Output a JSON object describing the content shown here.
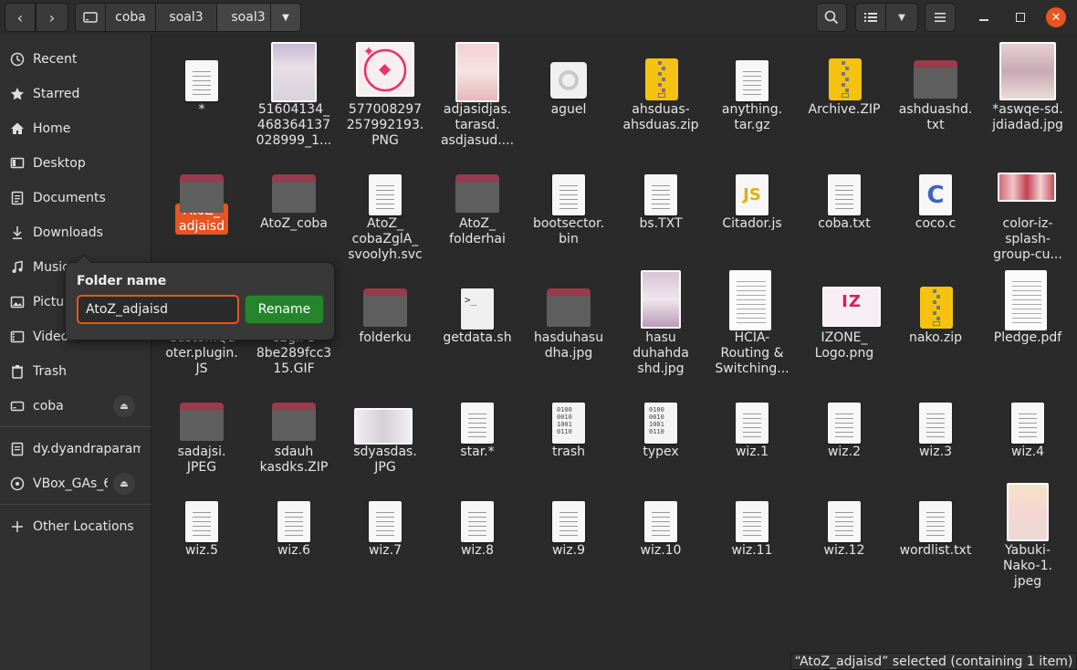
{
  "path": [
    "coba",
    "soal3",
    "soal3"
  ],
  "sidebar": {
    "items": [
      {
        "label": "Recent",
        "icon": "clock-icon"
      },
      {
        "label": "Starred",
        "icon": "star-icon"
      },
      {
        "label": "Home",
        "icon": "home-icon"
      },
      {
        "label": "Desktop",
        "icon": "desktop-icon"
      },
      {
        "label": "Documents",
        "icon": "documents-icon"
      },
      {
        "label": "Downloads",
        "icon": "download-icon"
      },
      {
        "label": "Music",
        "icon": "music-icon"
      },
      {
        "label": "Pictures",
        "icon": "pictures-icon"
      },
      {
        "label": "Videos",
        "icon": "videos-icon"
      },
      {
        "label": "Trash",
        "icon": "trash-icon"
      },
      {
        "label": "coba",
        "icon": "drive-icon"
      },
      {
        "label": "dy.dyandraparamitha...",
        "icon": "network-icon"
      },
      {
        "label": "VBox_GAs_6...",
        "icon": "disc-icon"
      },
      {
        "label": "Other Locations",
        "icon": "plus-icon"
      }
    ]
  },
  "files": [
    {
      "name": "*",
      "icon": "text"
    },
    {
      "name": "51604134_468364137028999_1...",
      "icon": "photo"
    },
    {
      "name": "577008297257992193.PNG",
      "icon": "png-logo"
    },
    {
      "name": "adjasidjas.tarasd.asdjasud....",
      "icon": "photo"
    },
    {
      "name": "aguel",
      "icon": "exec"
    },
    {
      "name": "ahsduas-ahsduas.zip",
      "icon": "zip"
    },
    {
      "name": "anything.tar.gz",
      "icon": "text"
    },
    {
      "name": "Archive.ZIP",
      "icon": "zip"
    },
    {
      "name": "ashduashd.txt",
      "icon": "folder"
    },
    {
      "name": "*aswqe-sd.jdiadad.jpg",
      "icon": "photo"
    },
    {
      "name": "AtoZ_adjaisd",
      "icon": "folder",
      "selected": true
    },
    {
      "name": "AtoZ_coba",
      "icon": "folder"
    },
    {
      "name": "AtoZ_cobaZglA_svoolyh.svc",
      "icon": "text"
    },
    {
      "name": "AtoZ_folderhai",
      "icon": "folder"
    },
    {
      "name": "bootsector.bin",
      "icon": "text"
    },
    {
      "name": "bs.TXT",
      "icon": "text"
    },
    {
      "name": "Citador.js",
      "icon": "js"
    },
    {
      "name": "coba.txt",
      "icon": "text"
    },
    {
      "name": "coco.c",
      "icon": "c"
    },
    {
      "name": "color-iz-splash-group-cu...",
      "icon": "group-photo"
    },
    {
      "name": "CustomQuoter.plugin.JS",
      "icon": "hidden"
    },
    {
      "name": "e2gif-58be289fcc315.GIF",
      "icon": "hidden"
    },
    {
      "name": "folderku",
      "icon": "folder"
    },
    {
      "name": "getdata.sh",
      "icon": "script"
    },
    {
      "name": "hasduhasudha.jpg",
      "icon": "folder"
    },
    {
      "name": "hasuduhahdashd.jpg",
      "icon": "photo"
    },
    {
      "name": "HCIA-Routing & Switching...",
      "icon": "pdf"
    },
    {
      "name": "IZONE_Logo.png",
      "icon": "izone"
    },
    {
      "name": "nako.zip",
      "icon": "zip"
    },
    {
      "name": "Pledge.pdf",
      "icon": "pdf"
    },
    {
      "name": "sadajsi.JPEG",
      "icon": "folder"
    },
    {
      "name": "sdauhkasdks.ZIP",
      "icon": "folder"
    },
    {
      "name": "sdyasdas.JPG",
      "icon": "wide-photo"
    },
    {
      "name": "star.*",
      "icon": "text"
    },
    {
      "name": "trash",
      "icon": "binary"
    },
    {
      "name": "typex",
      "icon": "binary"
    },
    {
      "name": "wiz.1",
      "icon": "text"
    },
    {
      "name": "wiz.2",
      "icon": "text"
    },
    {
      "name": "wiz.3",
      "icon": "text"
    },
    {
      "name": "wiz.4",
      "icon": "text"
    },
    {
      "name": "wiz.5",
      "icon": "text"
    },
    {
      "name": "wiz.6",
      "icon": "text"
    },
    {
      "name": "wiz.7",
      "icon": "text"
    },
    {
      "name": "wiz.8",
      "icon": "text"
    },
    {
      "name": "wiz.9",
      "icon": "text"
    },
    {
      "name": "wiz.10",
      "icon": "text"
    },
    {
      "name": "wiz.11",
      "icon": "text"
    },
    {
      "name": "wiz.12",
      "icon": "text"
    },
    {
      "name": "wordlist.txt",
      "icon": "text"
    },
    {
      "name": "Yabuki-Nako-1.jpeg",
      "icon": "photo"
    }
  ],
  "file_labels": [
    [
      "*"
    ],
    [
      "51604134_",
      "468364137",
      "028999_1..."
    ],
    [
      "577008297",
      "257992193.",
      "PNG"
    ],
    [
      "adjasidjas.",
      "tarasd.",
      "asdjasud...."
    ],
    [
      "aguel"
    ],
    [
      "ahsduas-",
      "ahsduas.zip"
    ],
    [
      "anything.",
      "tar.gz"
    ],
    [
      "Archive.ZIP"
    ],
    [
      "ashduashd.",
      "txt"
    ],
    [
      "*aswqe-sd.",
      "jdiadad.jpg"
    ],
    [
      "AtoZ_",
      "adjaisd"
    ],
    [
      "AtoZ_coba"
    ],
    [
      "AtoZ_",
      "cobaZglA_",
      "svoolyh.svc"
    ],
    [
      "AtoZ_",
      "folderhai"
    ],
    [
      "bootsector.",
      "bin"
    ],
    [
      "bs.TXT"
    ],
    [
      "Citador.js"
    ],
    [
      "coba.txt"
    ],
    [
      "coco.c"
    ],
    [
      "color-iz-",
      "splash-",
      "group-cu..."
    ],
    [
      "CustomQu",
      "oter.plugin.",
      "JS"
    ],
    [
      "e2gif-5",
      "8be289fcc3",
      "15.GIF"
    ],
    [
      "folderku"
    ],
    [
      "getdata.sh"
    ],
    [
      "hasduhasu",
      "dha.jpg"
    ],
    [
      "hasu",
      "duhahda",
      "shd.jpg"
    ],
    [
      "HCIA-",
      "Routing &",
      "Switching..."
    ],
    [
      "IZONE_",
      "Logo.png"
    ],
    [
      "nako.zip"
    ],
    [
      "Pledge.pdf"
    ],
    [
      "sadajsi.",
      "JPEG"
    ],
    [
      "sdauh",
      "kasdks.ZIP"
    ],
    [
      "sdyasdas.",
      "JPG"
    ],
    [
      "star.*"
    ],
    [
      "trash"
    ],
    [
      "typex"
    ],
    [
      "wiz.1"
    ],
    [
      "wiz.2"
    ],
    [
      "wiz.3"
    ],
    [
      "wiz.4"
    ],
    [
      "wiz.5"
    ],
    [
      "wiz.6"
    ],
    [
      "wiz.7"
    ],
    [
      "wiz.8"
    ],
    [
      "wiz.9"
    ],
    [
      "wiz.10"
    ],
    [
      "wiz.11"
    ],
    [
      "wiz.12"
    ],
    [
      "wordlist.txt"
    ],
    [
      "Yabuki-",
      "Nako-1.",
      "jpeg"
    ]
  ],
  "rename_popover": {
    "title": "Folder name",
    "value": "AtoZ_adjaisd",
    "button": "Rename"
  },
  "status": "“AtoZ_adjaisd” selected  (containing 1 item)",
  "colors": {
    "accent": "#e95420",
    "rename_button": "#26852c",
    "folder_tab": "#9a3a4a"
  }
}
